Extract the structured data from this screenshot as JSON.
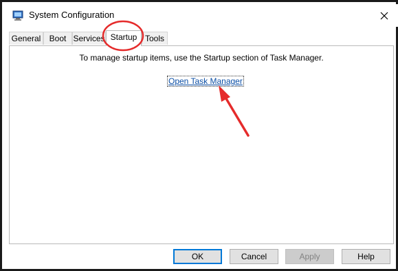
{
  "window": {
    "title": "System Configuration",
    "icon": "system-config-icon",
    "close_icon": "close-icon"
  },
  "tabs": [
    {
      "label": "General",
      "active": false
    },
    {
      "label": "Boot",
      "active": false
    },
    {
      "label": "Services",
      "active": false
    },
    {
      "label": "Startup",
      "active": true
    },
    {
      "label": "Tools",
      "active": false
    }
  ],
  "startup": {
    "message": "To manage startup items, use the Startup section of Task Manager.",
    "link_label": "Open Task Manager"
  },
  "buttons": {
    "ok": "OK",
    "cancel": "Cancel",
    "apply": "Apply",
    "help": "Help"
  },
  "colors": {
    "annotation": "#e52b2b",
    "link": "#0b4ea5",
    "focus_border": "#0078d7"
  }
}
